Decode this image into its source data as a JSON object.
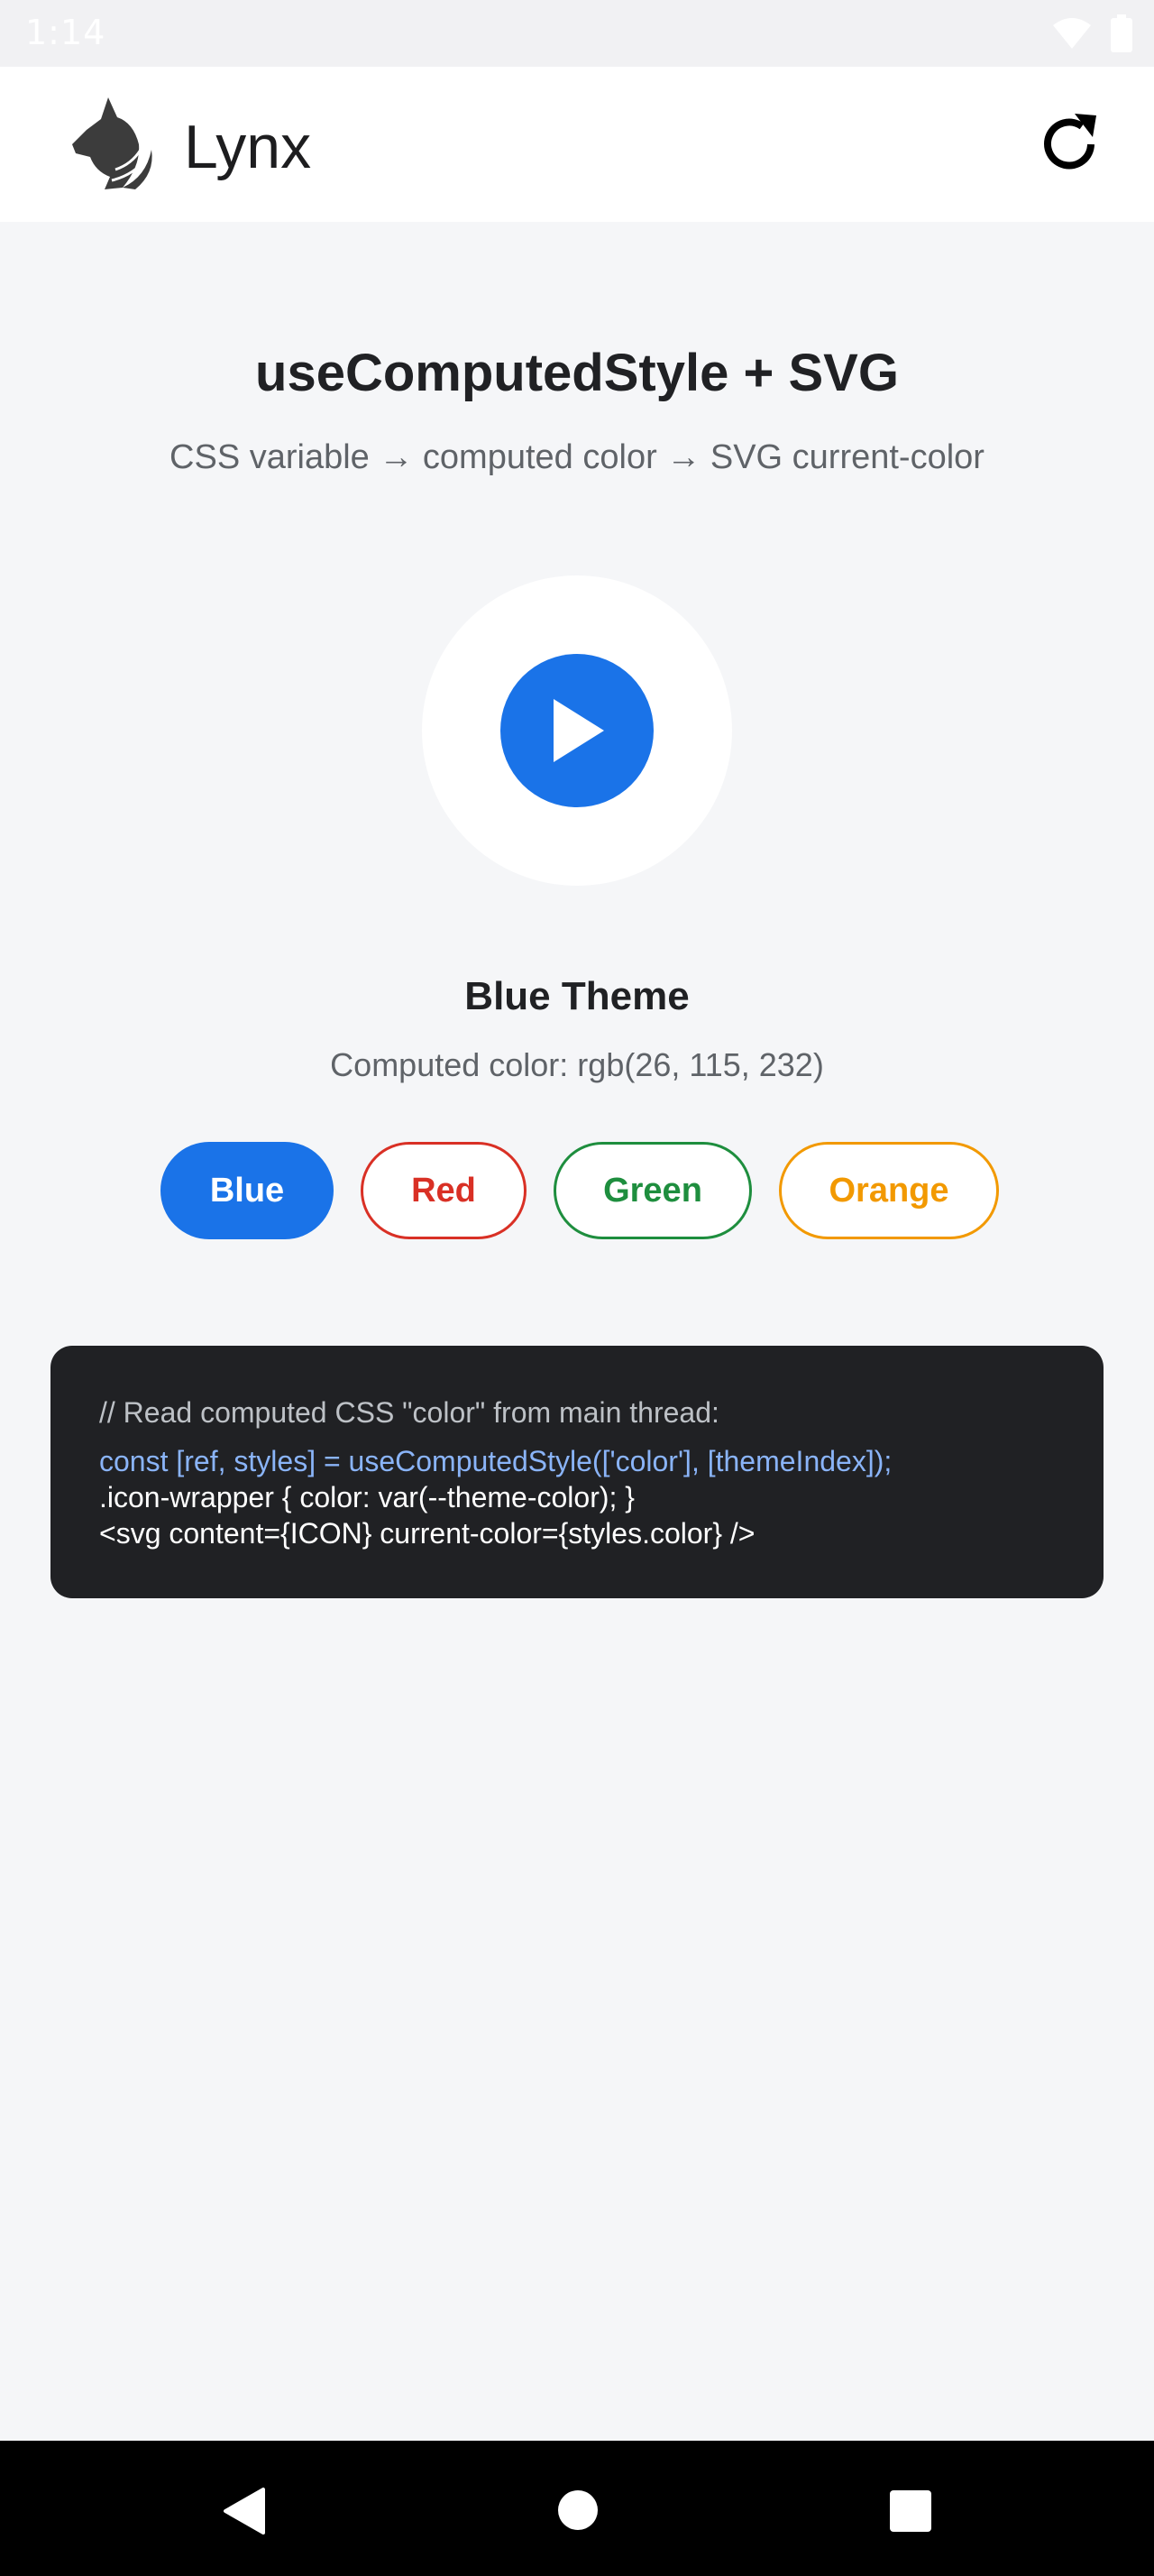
{
  "status_bar": {
    "time": "1:14",
    "icons": [
      "wifi-icon",
      "battery-icon"
    ]
  },
  "app_bar": {
    "title": "Lynx",
    "logo_icon": "lynx-logo-icon",
    "reload_icon": "reload-icon"
  },
  "main": {
    "title": "useComputedStyle + SVG",
    "subtitle": "CSS variable → computed color → SVG current-color",
    "icon": "play-icon",
    "theme_title": "Blue Theme",
    "computed_color": "Computed color: rgb(26, 115, 232)",
    "theme_buttons": [
      {
        "label": "Blue",
        "color": "#1a73e8",
        "selected": true
      },
      {
        "label": "Red",
        "color": "#d93025",
        "selected": false
      },
      {
        "label": "Green",
        "color": "#1e8e3e",
        "selected": false
      },
      {
        "label": "Orange",
        "color": "#f29900",
        "selected": false
      }
    ],
    "code": {
      "comment": "// Read computed CSS \"color\" from main thread:",
      "line1": "const [ref, styles] = useComputedStyle(['color'], [themeIndex]);",
      "line2": ".icon-wrapper { color: var(--theme-color); }",
      "line3": "<svg content={ICON} current-color={styles.color} />"
    }
  },
  "nav_bar": {
    "icons": [
      "back-icon",
      "home-icon",
      "recents-icon"
    ]
  },
  "colors": {
    "accent": "#1a73e8",
    "background": "#f5f6f8",
    "code_background": "#202124"
  }
}
